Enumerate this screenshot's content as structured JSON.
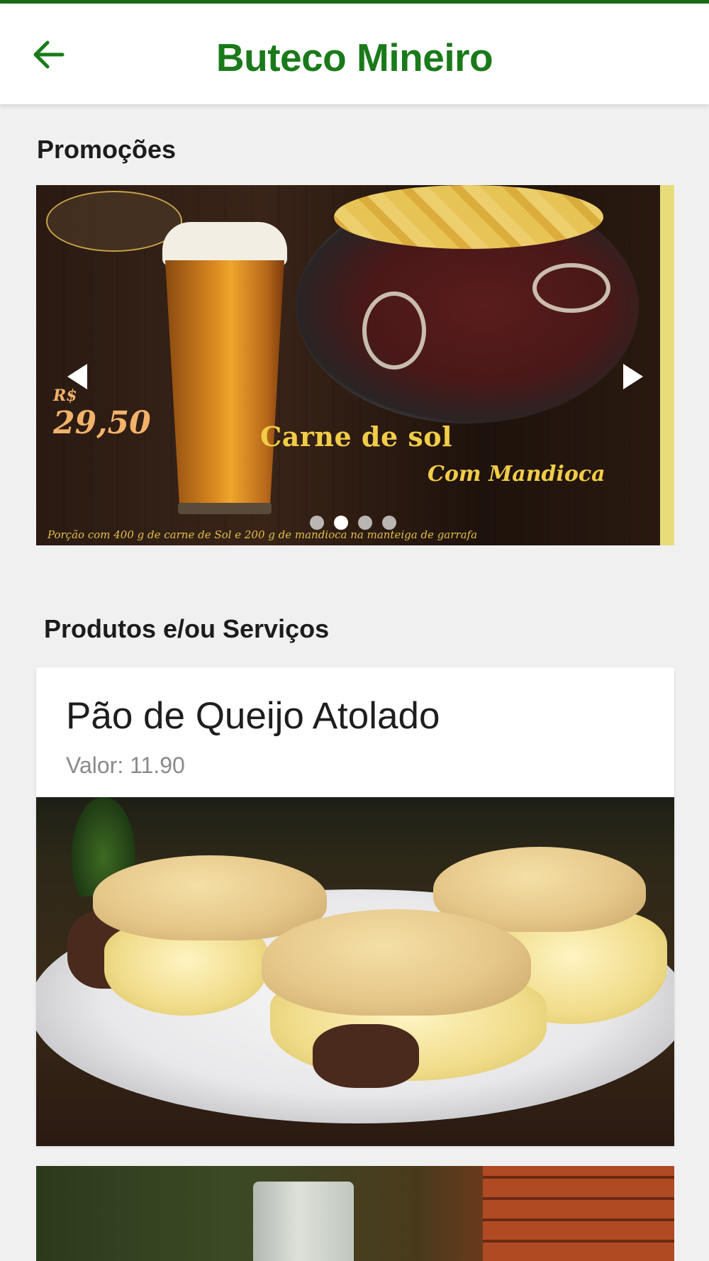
{
  "appbar": {
    "title": "Buteco Mineiro",
    "back_icon": "arrow-left-icon",
    "accent_color": "#1a7a1a"
  },
  "promotions": {
    "section_title": "Promoções",
    "banner": {
      "price_prefix": "R$",
      "price": "29,50",
      "name": "Carne de sol",
      "subtitle": "Com Mandioca",
      "note": "Porção com 400 g de carne de Sol e 200 g de mandioca na manteiga de garrafa"
    },
    "prev_icon": "chevron-left-icon",
    "next_icon": "chevron-right-icon",
    "slides_count": 4,
    "active_slide": 2
  },
  "products": {
    "section_title": "Produtos e/ou Serviços",
    "items": [
      {
        "name": "Pão de Queijo Atolado",
        "price_text": "Valor: 11.90"
      }
    ]
  }
}
